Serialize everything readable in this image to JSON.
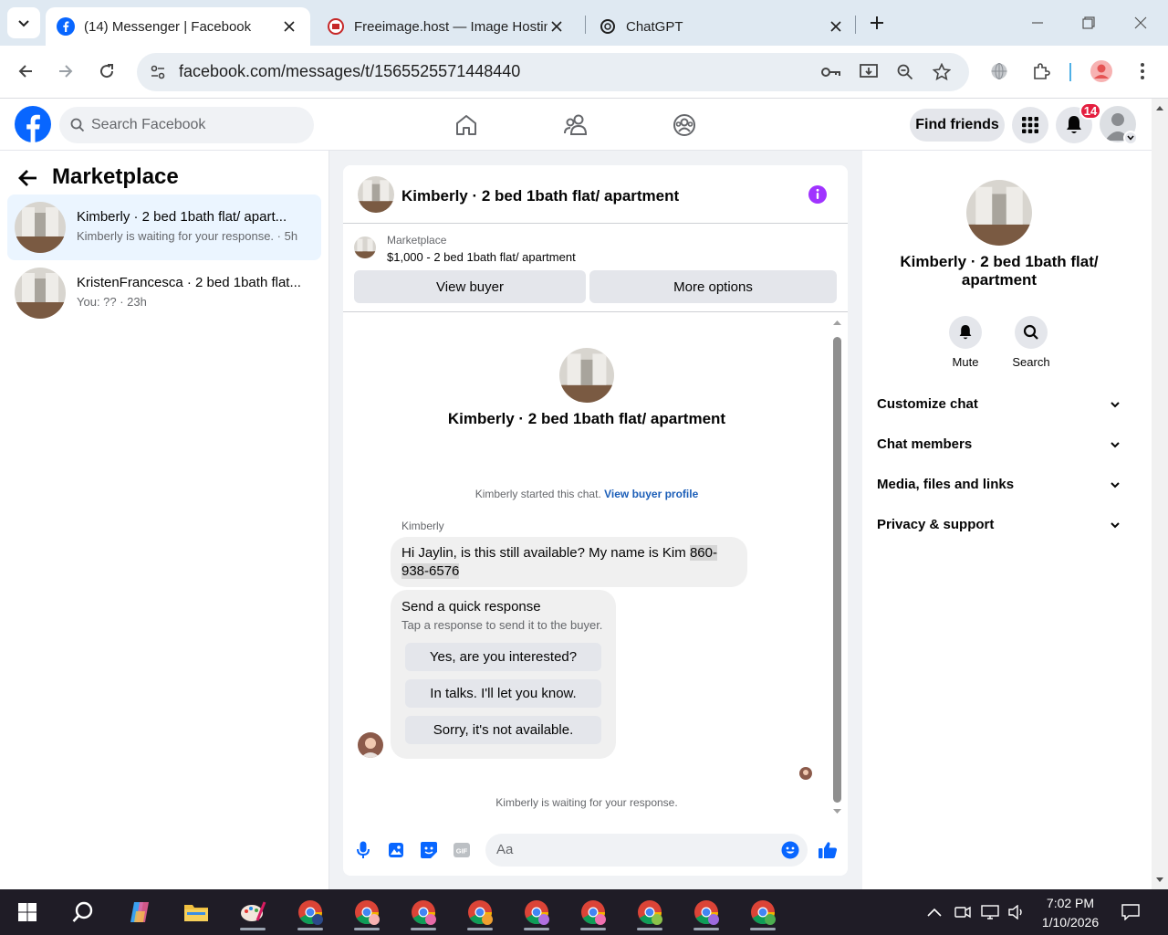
{
  "browser": {
    "tabs": [
      {
        "title": "(14) Messenger | Facebook",
        "active": true
      },
      {
        "title": "Freeimage.host — Image Hosting",
        "active": false
      },
      {
        "title": "ChatGPT",
        "active": false
      }
    ],
    "url": "facebook.com/messages/t/1565525571448440"
  },
  "fb_header": {
    "search_placeholder": "Search Facebook",
    "find_friends": "Find friends",
    "notification_count": "14"
  },
  "left_panel": {
    "title": "Marketplace",
    "conversations": [
      {
        "name": "Kimberly · 2 bed 1bath flat/ apart...",
        "preview": "Kimberly is waiting for your response. · 5h",
        "selected": true
      },
      {
        "name": "KristenFrancesca · 2 bed 1bath flat...",
        "preview": "You: ?? · 23h",
        "selected": false
      }
    ]
  },
  "chat": {
    "header_name": "Kimberly · 2 bed 1bath flat/ apartment",
    "listing_source": "Marketplace",
    "listing_price_title": "$1,000 - 2 bed 1bath flat/ apartment",
    "view_buyer": "View buyer",
    "more_options": "More options",
    "thread_name": "Kimberly · 2 bed 1bath flat/ apartment",
    "started_text": "Kimberly started this chat.",
    "started_link": "View buyer profile",
    "sender": "Kimberly",
    "message_text": "Hi Jaylin, is this still available?  My name is Kim ",
    "message_phone_a": "860-",
    "message_phone_b": "938-6576",
    "quick_title": "Send a quick response",
    "quick_sub": "Tap a response to send it to the buyer.",
    "quick_responses": [
      "Yes, are you interested?",
      "In talks. I'll let you know.",
      "Sorry, it's not available."
    ],
    "waiting": "Kimberly is waiting for your response.",
    "input_placeholder": "Aa"
  },
  "right_panel": {
    "name": "Kimberly · 2 bed 1bath flat/ apartment",
    "mute": "Mute",
    "search": "Search",
    "sections": [
      "Customize chat",
      "Chat members",
      "Media, files and links",
      "Privacy & support"
    ]
  },
  "taskbar": {
    "time": "7:02 PM",
    "date": "1/10/2026"
  },
  "colors": {
    "fb_blue": "#0866ff",
    "link_blue": "#1b5eb8",
    "badge_red": "#e41e3f",
    "info_purple": "#a033ff"
  }
}
